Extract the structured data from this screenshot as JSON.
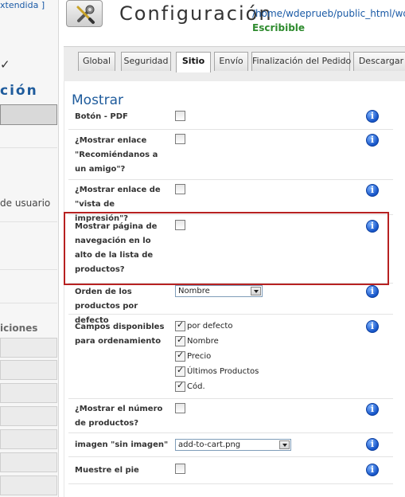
{
  "sidebar": {
    "top_link": "xtendida",
    "top_bracket": " ]",
    "title": "ción",
    "user_label": "de usuario",
    "section_label": "iciones"
  },
  "header": {
    "title": "Configuración",
    "path": "/home/wdeprueb/public_html/wdew",
    "status": "Escribible"
  },
  "tabs": [
    {
      "label": "Global"
    },
    {
      "label": "Seguridad"
    },
    {
      "label": "Sitio",
      "active": true
    },
    {
      "label": "Envío"
    },
    {
      "label": "Finalización del Pedido"
    },
    {
      "label": "Descargar"
    }
  ],
  "section": {
    "title": "Mostrar",
    "rows": [
      {
        "label": "Botón - PDF",
        "type": "checkbox",
        "checked": false
      },
      {
        "label": "¿Mostrar enlace \"Recomiéndanos a un amigo\"?",
        "type": "checkbox",
        "checked": false
      },
      {
        "label": "¿Mostrar enlace de \"vista de impresión\"?",
        "type": "checkbox",
        "checked": false
      },
      {
        "label": "Mostrar página de navegación en lo alto de la lista de productos?",
        "type": "checkbox",
        "checked": false
      },
      {
        "label": "Orden de los productos por defecto",
        "type": "select",
        "value": "Nombre"
      },
      {
        "label": "Campos disponibles para ordenamiento",
        "type": "checklist",
        "options": [
          {
            "label": "por defecto",
            "checked": true
          },
          {
            "label": "Nombre",
            "checked": true
          },
          {
            "label": "Precio",
            "checked": true
          },
          {
            "label": "Últimos Productos",
            "checked": true
          },
          {
            "label": "Cód.",
            "checked": true
          }
        ]
      },
      {
        "label": "¿Mostrar el número de productos?",
        "type": "checkbox",
        "checked": false
      },
      {
        "label": "imagen \"sin imagen\"",
        "type": "select",
        "value": "add-to-cart.png"
      },
      {
        "label": "Muestre el pie",
        "type": "checkbox",
        "checked": false
      }
    ]
  },
  "info_glyph": "i",
  "colors": {
    "heading_blue": "#1e5b9c",
    "status_green": "#2e8b2e",
    "highlight_red": "#b72121"
  }
}
